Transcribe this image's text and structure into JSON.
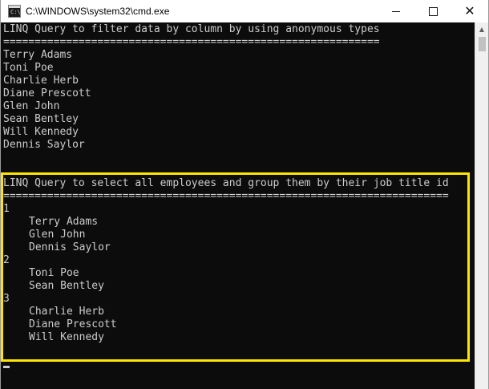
{
  "window": {
    "title": "C:\\WINDOWS\\system32\\cmd.exe",
    "icon_text": "C:\\"
  },
  "console": {
    "section1": {
      "header": "LINQ Query to filter data by column by using anonymous types",
      "separator": "============================================================",
      "names": [
        "Terry Adams",
        "Toni Poe",
        "Charlie Herb",
        "Diane Prescott",
        "Glen John",
        "Sean Bentley",
        "Will Kennedy",
        "Dennis Saylor"
      ]
    },
    "section2": {
      "header": "LINQ Query to select all employees and group them by their job title id",
      "separator": "=======================================================================",
      "groups": [
        {
          "id": "1",
          "members": [
            "Terry Adams",
            "Glen John",
            "Dennis Saylor"
          ]
        },
        {
          "id": "2",
          "members": [
            "Toni Poe",
            "Sean Bentley"
          ]
        },
        {
          "id": "3",
          "members": [
            "Charlie Herb",
            "Diane Prescott",
            "Will Kennedy"
          ]
        }
      ]
    }
  },
  "colors": {
    "console_bg": "#0c0c0c",
    "console_text": "#cccccc",
    "highlight": "#ffe600"
  }
}
